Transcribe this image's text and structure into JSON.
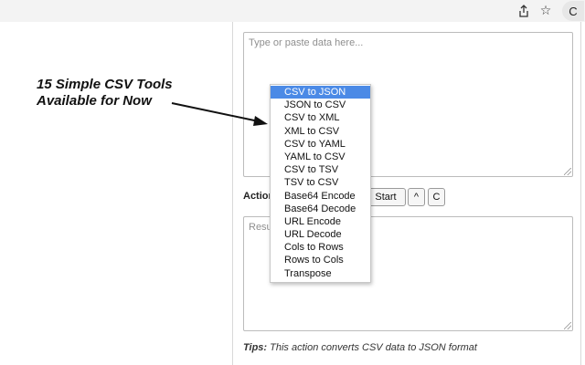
{
  "toolbar": {
    "icons": [
      "share-icon",
      "star-icon",
      "extension-icon"
    ],
    "extension_label": "C"
  },
  "annotation": {
    "line1": "15 Simple CSV Tools",
    "line2": "Available for Now"
  },
  "input": {
    "placeholder": "Type or paste data here..."
  },
  "action": {
    "label": "Action",
    "start_label": "Start",
    "up_label": "^",
    "clear_label": "C"
  },
  "result": {
    "placeholder": "Result"
  },
  "dropdown": {
    "selected": "CSV to JSON",
    "options": [
      "CSV to JSON",
      "JSON to CSV",
      "CSV to XML",
      "XML to CSV",
      "CSV to YAML",
      "YAML to CSV",
      "CSV to TSV",
      "TSV to CSV",
      "Base64 Encode",
      "Base64 Decode",
      "URL Encode",
      "URL Decode",
      "Cols to Rows",
      "Rows to Cols",
      "Transpose"
    ]
  },
  "tips": {
    "label": "Tips:",
    "text": "This action converts CSV data to JSON format"
  }
}
